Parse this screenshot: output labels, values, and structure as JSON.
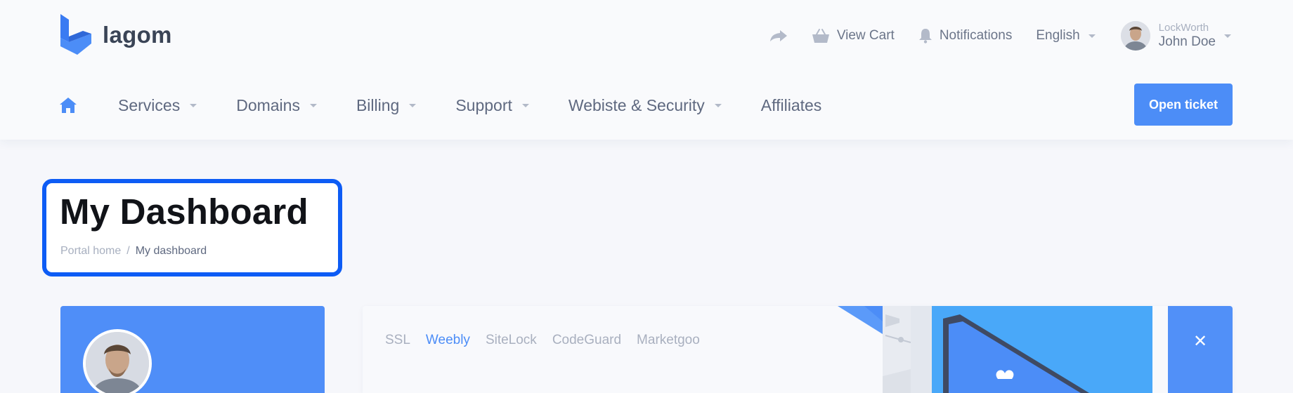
{
  "brand": {
    "name": "lagom"
  },
  "topbar": {
    "share_icon": "share-arrow-icon",
    "cart_label": "View Cart",
    "notifications_label": "Notifications",
    "language": "English",
    "user": {
      "company": "LockWorth",
      "name": "John Doe"
    }
  },
  "nav": {
    "home_icon": "home-icon",
    "items": [
      {
        "label": "Services"
      },
      {
        "label": "Domains"
      },
      {
        "label": "Billing"
      },
      {
        "label": "Support"
      },
      {
        "label": "Webiste & Security"
      },
      {
        "label": "Affiliates"
      }
    ],
    "open_ticket_label": "Open ticket"
  },
  "page": {
    "title": "My Dashboard",
    "breadcrumb": {
      "home": "Portal home",
      "separator": "/",
      "current": "My dashboard"
    }
  },
  "promo": {
    "tabs": [
      {
        "label": "SSL"
      },
      {
        "label": "Weebly"
      },
      {
        "label": "SiteLock"
      },
      {
        "label": "CodeGuard"
      },
      {
        "label": "Marketgoo"
      }
    ],
    "active_tab": "Weebly",
    "close_label": "✕"
  },
  "colors": {
    "accent": "#4c8df7",
    "highlight_border": "#0d5cf5",
    "text": "#5f6980",
    "muted": "#a7afbf"
  }
}
